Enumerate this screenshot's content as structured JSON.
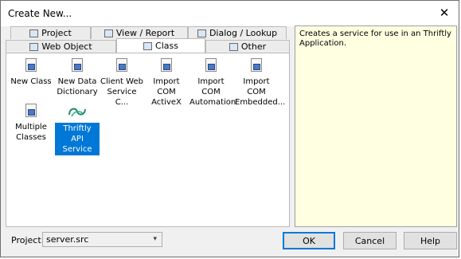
{
  "window": {
    "title": "Create New...",
    "close_glyph": "✕"
  },
  "tabs": {
    "row_back": [
      {
        "label": "Project",
        "icon": "project-icon"
      },
      {
        "label": "View / Report",
        "icon": "view-report-icon"
      },
      {
        "label": "Dialog / Lookup",
        "icon": "dialog-lookup-icon"
      }
    ],
    "row_front": [
      {
        "label": "Web Object",
        "icon": "web-object-icon"
      },
      {
        "label": "Class",
        "icon": "class-icon",
        "selected": true
      },
      {
        "label": "Other",
        "icon": "other-icon"
      }
    ]
  },
  "items": [
    {
      "label_line1": "New Class",
      "label_line2": "",
      "icon": "class-file-icon"
    },
    {
      "label_line1": "New Data",
      "label_line2": "Dictionary",
      "icon": "class-file-icon"
    },
    {
      "label_line1": "Client Web",
      "label_line2": "Service C...",
      "icon": "class-file-icon"
    },
    {
      "label_line1": "Import COM",
      "label_line2": "ActiveX",
      "icon": "class-file-icon"
    },
    {
      "label_line1": "Import COM",
      "label_line2": "Automation",
      "icon": "class-file-icon"
    },
    {
      "label_line1": "Import COM",
      "label_line2": "Embedded...",
      "icon": "class-file-icon"
    },
    {
      "label_line1": "Multiple",
      "label_line2": "Classes",
      "icon": "class-file-icon"
    },
    {
      "label_line1": "Thriftly API",
      "label_line2": "Service",
      "icon": "thriftly-icon",
      "selected": true
    }
  ],
  "description": "Creates a service for use in an Thriftly Application.",
  "footer": {
    "project_label": "Project:",
    "project_value": "server.src",
    "ok": "OK",
    "cancel": "Cancel",
    "help": "Help"
  },
  "colors": {
    "selection": "#0078d7",
    "description_bg": "#ffffe1",
    "thriftly_accent": "#1f8a6a"
  }
}
